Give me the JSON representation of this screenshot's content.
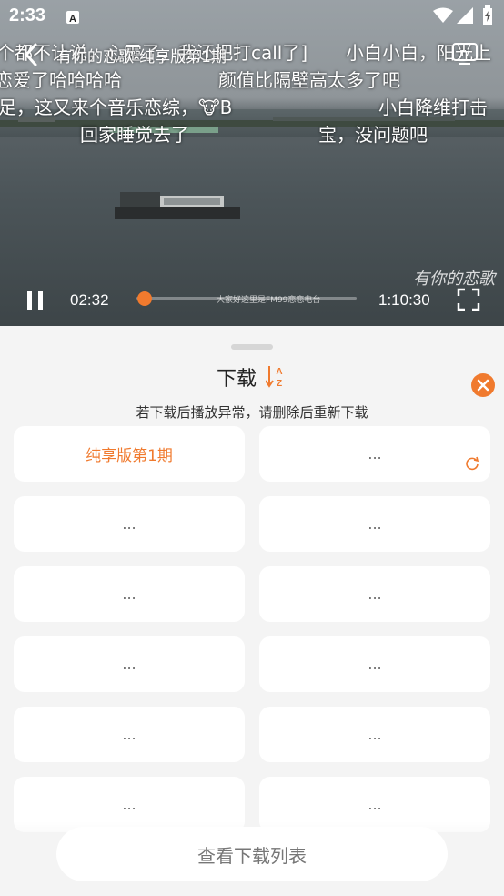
{
  "status_bar": {
    "time": "2:33"
  },
  "player": {
    "title": "有你的恋歌-纯享版第1期",
    "current_time": "02:32",
    "total_time": "1:10:30",
    "progress": 0.036,
    "watermark": "有你的恋歌",
    "caption_overlay": "大家好这里是FM99恋恋电台",
    "danmaku": [
      "个都不让说，心靈了，我还把打call了]",
      "小白小白，阳光上",
      "恋爱了哈哈哈哈",
      "颜值比隔壁高太多了吧",
      "足，这又来个音乐恋综，🐮B",
      "小白降维打击",
      "回家睡觉去了",
      "宝，没问题吧"
    ]
  },
  "download_panel": {
    "title": "下载",
    "sort_icon_top": "A",
    "sort_icon_bottom": "Z",
    "hint": "若下载后播放异常，请删除后重新下载",
    "episodes": [
      {
        "label": "纯享版第1期",
        "active": true
      },
      {
        "label": "...",
        "active": false,
        "downloading": true
      },
      {
        "label": "...",
        "active": false
      },
      {
        "label": "...",
        "active": false
      },
      {
        "label": "...",
        "active": false
      },
      {
        "label": "...",
        "active": false
      },
      {
        "label": "...",
        "active": false
      },
      {
        "label": "...",
        "active": false
      },
      {
        "label": "...",
        "active": false
      },
      {
        "label": "...",
        "active": false
      },
      {
        "label": "...",
        "active": false
      },
      {
        "label": "...",
        "active": false
      }
    ],
    "view_list_button": "查看下载列表"
  },
  "colors": {
    "accent": "#f07a2e"
  }
}
